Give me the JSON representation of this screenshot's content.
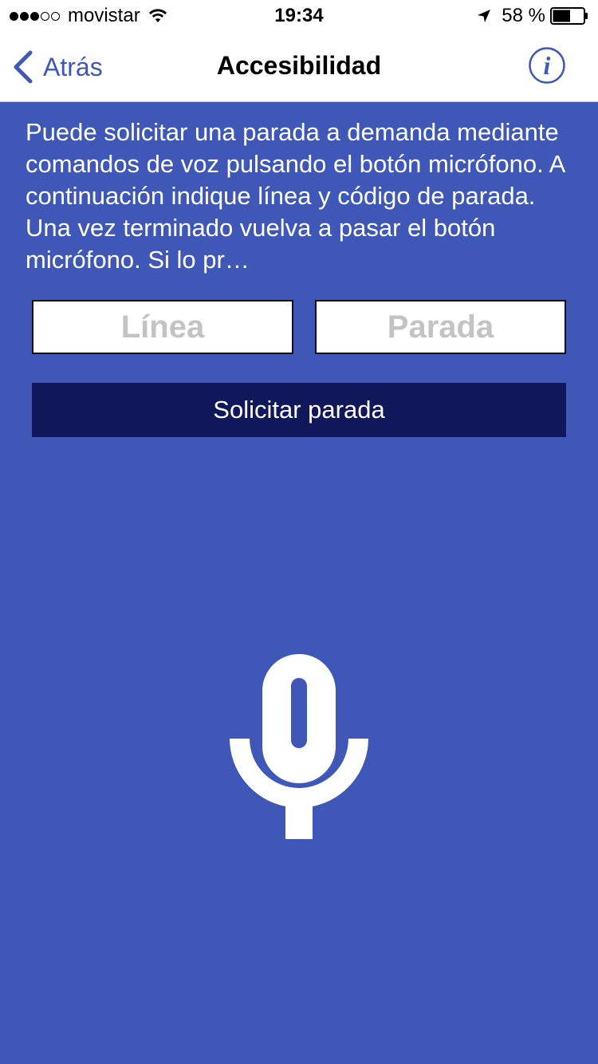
{
  "status_bar": {
    "carrier": "movistar",
    "time": "19:34",
    "battery_percent": "58 %",
    "signal_bars_filled": 3,
    "signal_bars_total": 5,
    "battery_level": 0.58,
    "icons": [
      "wifi-icon",
      "location-arrow-icon",
      "battery-icon"
    ]
  },
  "nav": {
    "back_label": "Atrás",
    "title": "Accesibilidad",
    "back_icon": "chevron-left-icon",
    "info_icon": "info-icon"
  },
  "main": {
    "instructions": "Puede solicitar una parada a demanda mediante comandos de voz pulsando el botón micrófono. A continuación indique línea y código de parada. Una vez terminado vuelva a pasar el botón micrófono. Si lo pr…",
    "line_field": {
      "placeholder": "Línea",
      "value": ""
    },
    "stop_field": {
      "placeholder": "Parada",
      "value": ""
    },
    "request_button_label": "Solicitar parada",
    "mic_icon": "microphone-icon"
  },
  "colors": {
    "background": "#3f58b8",
    "accent": "#3f58b8",
    "button": "#10175a",
    "text_light": "#ffffff",
    "placeholder": "#c3c3c3"
  }
}
